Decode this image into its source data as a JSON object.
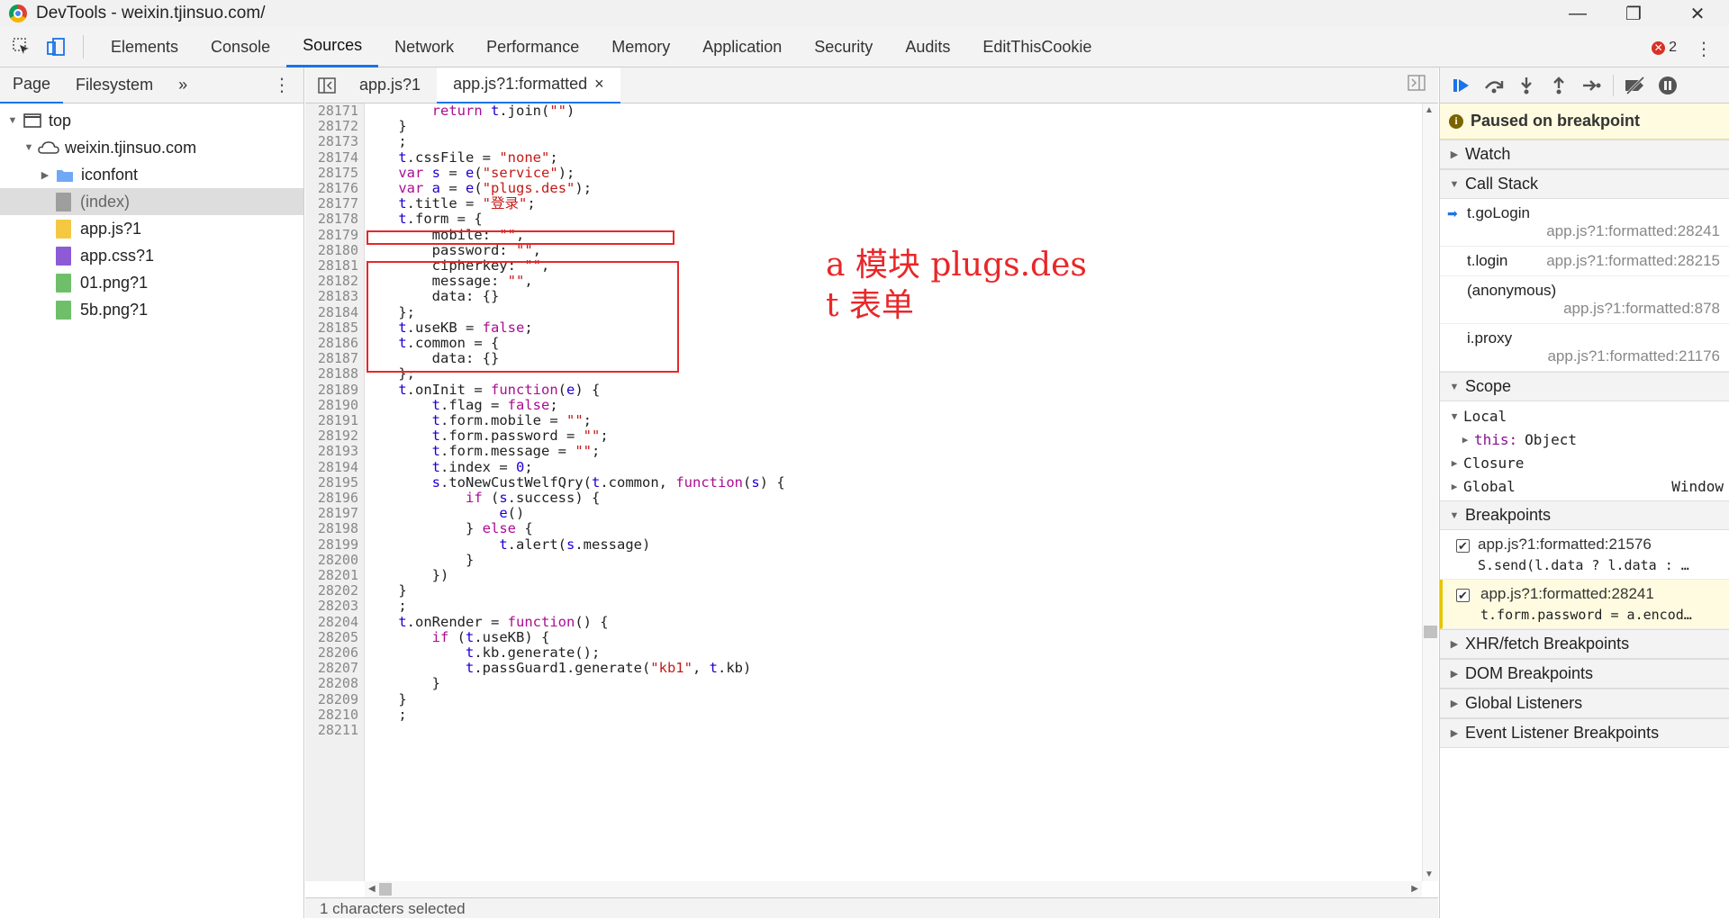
{
  "window": {
    "title": "DevTools - weixin.tjinsuo.com/",
    "minimize": "—",
    "maximize": "❐",
    "close": "✕"
  },
  "toolbar": {
    "tabs": [
      "Elements",
      "Console",
      "Sources",
      "Network",
      "Performance",
      "Memory",
      "Application",
      "Security",
      "Audits",
      "EditThisCookie"
    ],
    "active_tab": "Sources",
    "error_count": "2"
  },
  "navigator": {
    "tabs": [
      "Page",
      "Filesystem"
    ],
    "more": "»",
    "tree": [
      {
        "label": "top",
        "level": 0,
        "icon": "window-icon",
        "expanded": true
      },
      {
        "label": "weixin.tjinsuo.com",
        "level": 1,
        "icon": "cloud-icon",
        "expanded": true
      },
      {
        "label": "iconfont",
        "level": 2,
        "icon": "folder-icon",
        "expanded": false
      },
      {
        "label": "(index)",
        "level": 2,
        "icon": "doc-icon",
        "selected": true
      },
      {
        "label": "app.js?1",
        "level": 2,
        "icon": "js-icon"
      },
      {
        "label": "app.css?1",
        "level": 2,
        "icon": "css-icon"
      },
      {
        "label": "01.png?1",
        "level": 2,
        "icon": "img-icon"
      },
      {
        "label": "5b.png?1",
        "level": 2,
        "icon": "img-icon"
      }
    ]
  },
  "editor": {
    "tabs": [
      {
        "label": "app.js?1",
        "active": false
      },
      {
        "label": "app.js?1:formatted",
        "active": true,
        "close": "×"
      }
    ],
    "lines": [
      {
        "n": "28171",
        "code": "        return t.join(\"\")"
      },
      {
        "n": "28172",
        "code": "    }"
      },
      {
        "n": "28173",
        "code": "    ;"
      },
      {
        "n": "28174",
        "code": "    t.cssFile = \"none\";"
      },
      {
        "n": "28175",
        "code": "    var s = e(\"service\");"
      },
      {
        "n": "28176",
        "code": "    var a = e(\"plugs.des\");"
      },
      {
        "n": "28177",
        "code": "    t.title = \"登录\";"
      },
      {
        "n": "28178",
        "code": "    t.form = {"
      },
      {
        "n": "28179",
        "code": "        mobile: \"\","
      },
      {
        "n": "28180",
        "code": "        password: \"\","
      },
      {
        "n": "28181",
        "code": "        cipherkey: \"\","
      },
      {
        "n": "28182",
        "code": "        message: \"\","
      },
      {
        "n": "28183",
        "code": "        data: {}"
      },
      {
        "n": "28184",
        "code": "    };"
      },
      {
        "n": "28185",
        "code": "    t.useKB = false;"
      },
      {
        "n": "28186",
        "code": "    t.common = {"
      },
      {
        "n": "28187",
        "code": "        data: {}"
      },
      {
        "n": "28188",
        "code": "    };"
      },
      {
        "n": "28189",
        "code": "    t.onInit = function(e) {"
      },
      {
        "n": "28190",
        "code": "        t.flag = false;"
      },
      {
        "n": "28191",
        "code": "        t.form.mobile = \"\";"
      },
      {
        "n": "28192",
        "code": "        t.form.password = \"\";"
      },
      {
        "n": "28193",
        "code": "        t.form.message = \"\";"
      },
      {
        "n": "28194",
        "code": "        t.index = 0;"
      },
      {
        "n": "28195",
        "code": "        s.toNewCustWelfQry(t.common, function(s) {"
      },
      {
        "n": "28196",
        "code": "            if (s.success) {"
      },
      {
        "n": "28197",
        "code": "                e()"
      },
      {
        "n": "28198",
        "code": "            } else {"
      },
      {
        "n": "28199",
        "code": "                t.alert(s.message)"
      },
      {
        "n": "28200",
        "code": "            }"
      },
      {
        "n": "28201",
        "code": "        })"
      },
      {
        "n": "28202",
        "code": "    }"
      },
      {
        "n": "28203",
        "code": "    ;"
      },
      {
        "n": "28204",
        "code": "    t.onRender = function() {"
      },
      {
        "n": "28205",
        "code": "        if (t.useKB) {"
      },
      {
        "n": "28206",
        "code": "            t.kb.generate();"
      },
      {
        "n": "28207",
        "code": "            t.passGuard1.generate(\"kb1\", t.kb)"
      },
      {
        "n": "28208",
        "code": "        }"
      },
      {
        "n": "28209",
        "code": "    }"
      },
      {
        "n": "28210",
        "code": "    ;"
      },
      {
        "n": "28211",
        "code": ""
      }
    ],
    "annotations": [
      "a 模块 plugs.des",
      "t 表单"
    ],
    "status": "1 characters selected"
  },
  "debugger": {
    "paused_text": "Paused on breakpoint",
    "sections": {
      "watch": "Watch",
      "call_stack": "Call Stack",
      "scope": "Scope",
      "breakpoints": "Breakpoints",
      "xhr": "XHR/fetch Breakpoints",
      "dom": "DOM Breakpoints",
      "global_listeners": "Global Listeners",
      "event_listeners": "Event Listener Breakpoints"
    },
    "call_stack": [
      {
        "fn": "t.goLogin",
        "loc": "app.js?1:formatted:28241",
        "current": true
      },
      {
        "fn": "t.login",
        "loc": "app.js?1:formatted:28215"
      },
      {
        "fn": "(anonymous)",
        "loc": "app.js?1:formatted:878"
      },
      {
        "fn": "i.proxy",
        "loc": "app.js?1:formatted:21176"
      }
    ],
    "scope": {
      "local": "Local",
      "this_key": "this:",
      "this_val": "Object",
      "closure": "Closure",
      "global": "Global",
      "global_val": "Window"
    },
    "breakpoints": [
      {
        "loc": "app.js?1:formatted:21576",
        "code": "S.send(l.data ? l.data : …",
        "active": false
      },
      {
        "loc": "app.js?1:formatted:28241",
        "code": "t.form.password = a.encod…",
        "active": true
      }
    ]
  }
}
